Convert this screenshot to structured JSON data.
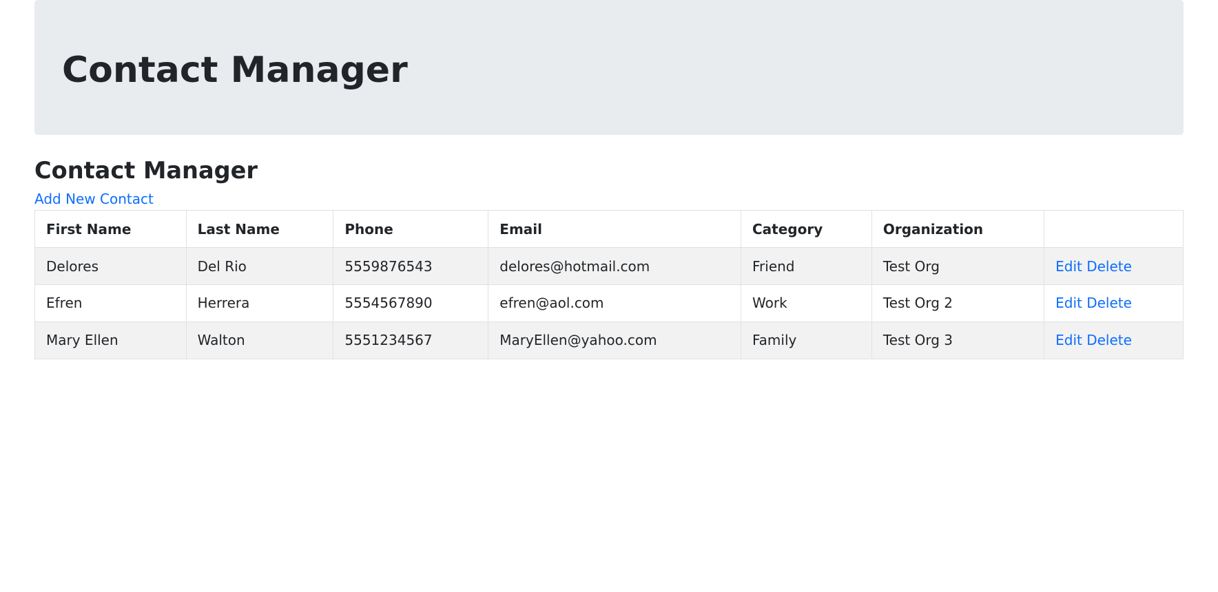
{
  "banner": {
    "title": "Contact Manager"
  },
  "page": {
    "heading": "Contact Manager",
    "add_link_label": "Add New Contact"
  },
  "table": {
    "headers": {
      "first_name": "First Name",
      "last_name": "Last Name",
      "phone": "Phone",
      "email": "Email",
      "category": "Category",
      "organization": "Organization",
      "actions": ""
    },
    "actions": {
      "edit": "Edit",
      "delete": "Delete"
    },
    "rows": [
      {
        "first_name": "Delores",
        "last_name": "Del Rio",
        "phone": "5559876543",
        "email": "delores@hotmail.com",
        "category": "Friend",
        "organization": "Test Org"
      },
      {
        "first_name": "Efren",
        "last_name": "Herrera",
        "phone": "5554567890",
        "email": "efren@aol.com",
        "category": "Work",
        "organization": "Test Org 2"
      },
      {
        "first_name": "Mary Ellen",
        "last_name": "Walton",
        "phone": "5551234567",
        "email": "MaryEllen@yahoo.com",
        "category": "Family",
        "organization": "Test Org 3"
      }
    ]
  }
}
